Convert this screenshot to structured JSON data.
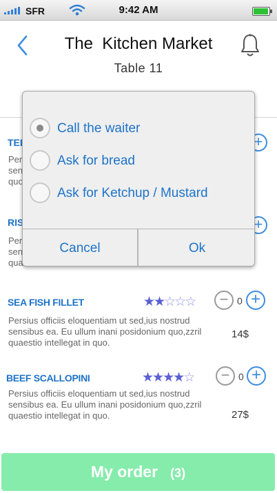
{
  "status_bar": {
    "carrier": "SFR",
    "time": "9:42 AM",
    "icons": [
      "signal-icon",
      "wifi-icon",
      "battery-icon"
    ]
  },
  "header": {
    "title": "The  Kitchen Market",
    "subtitle": "Table 11",
    "back_icon": "chevron-left-icon",
    "bell_icon": "bell-icon"
  },
  "hidden_items": [
    {
      "name": "TEL",
      "desc": [
        "Pers",
        "sen",
        "quo"
      ]
    },
    {
      "name": "RIS",
      "desc": [
        "Pers",
        "sen",
        "qua"
      ]
    }
  ],
  "menu_items": [
    {
      "name": "SEA FISH FILLET",
      "rating": 2,
      "rating_max": 5,
      "description": "Persius officiis eloquentiam ut sed,ius nostrud sensibus ea. Eu ullum inani posidonium quo,zzril quaestio intellegat in quo.",
      "quantity": "0",
      "price": "14$"
    },
    {
      "name": "BEEF SCALLOPINI",
      "rating": 4,
      "rating_max": 5,
      "description": "Persius officiis eloquentiam ut sed,ius nostrud sensibus ea. Eu ullum inani posidonium quo,zzril quaestio intellegat in quo.",
      "quantity": "0",
      "price": "27$"
    }
  ],
  "popup": {
    "options": [
      {
        "label": "Call the waiter",
        "selected": true
      },
      {
        "label": "Ask for bread",
        "selected": false
      },
      {
        "label": "Ask for Ketchup / Mustard",
        "selected": false
      }
    ],
    "cancel_label": "Cancel",
    "ok_label": "Ok"
  },
  "footer": {
    "order_label": "My order",
    "order_count": "(3)"
  },
  "colors": {
    "accent": "#1e73c8",
    "order_button": "#86ecab",
    "star": "#5a5fd2"
  }
}
